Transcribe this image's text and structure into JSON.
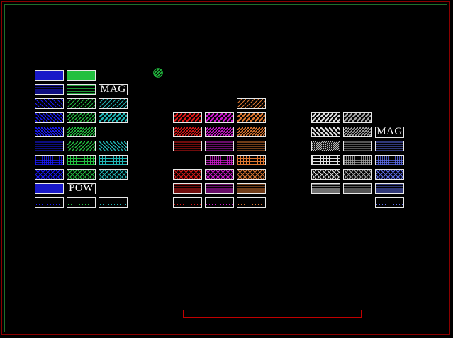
{
  "colors": {
    "background": "#000000",
    "border": "#e8e8e8",
    "blue": "#1a1aff",
    "blue_fill": "#1818c8",
    "green": "#22c040",
    "teal": "#20b8b8",
    "red": "#e01818",
    "magenta": "#d018d0",
    "orange": "#e07830",
    "white": "#e0e0e0",
    "gray": "#a8a8a8",
    "slate": "#6070f0"
  },
  "indicator": {
    "icon": "hatched-circle-icon",
    "color": "#22c040"
  },
  "palette_groups": [
    {
      "name": "group-1",
      "columns": [
        {
          "name": "blue",
          "swatches": [
            "solid",
            "h-dense",
            "d-back-sparse",
            "d-back-med",
            "d-back-dense",
            "h-dense",
            "grid-fine",
            "cross-diag",
            "solid-blue",
            "dots"
          ]
        },
        {
          "name": "green",
          "swatches": [
            "solid",
            "h-stripes",
            "d-fwd-sparse",
            "d-fwd-med",
            "d-fwd-dense",
            "d-fwd-med2",
            "grid-med",
            "cross-diag",
            "label",
            "dots"
          ]
        },
        {
          "name": "teal",
          "swatches": [
            "none",
            "label",
            "d-fwd-sparse",
            "d-fwd-bold",
            "none",
            "d-back-med",
            "grid-med",
            "cross-diag",
            "none",
            "dots"
          ]
        }
      ]
    },
    {
      "name": "group-2",
      "columns": [
        {
          "name": "red",
          "swatches": [
            "none",
            "none",
            "none",
            "d-fwd-bold",
            "d-fwd-dense",
            "h-dense",
            "none",
            "cross-diag",
            "h-dense",
            "dots"
          ]
        },
        {
          "name": "magenta",
          "swatches": [
            "none",
            "none",
            "none",
            "d-fwd-bold",
            "d-fwd-dense",
            "h-dense",
            "grid-fine",
            "cross-diag",
            "h-dense",
            "dots"
          ]
        },
        {
          "name": "orange",
          "swatches": [
            "none",
            "none",
            "d-fwd-sparse",
            "d-fwd-bold",
            "d-fwd-dense",
            "h-dense",
            "grid-med",
            "cross-diag",
            "h-dense",
            "dots"
          ]
        }
      ]
    },
    {
      "name": "group-3",
      "columns": [
        {
          "name": "white",
          "swatches": [
            "none",
            "none",
            "none",
            "d-fwd-bold",
            "d-back-bold",
            "d-fwd-fine",
            "grid-med",
            "cross-diag",
            "h-dense",
            "none"
          ]
        },
        {
          "name": "gray",
          "swatches": [
            "none",
            "none",
            "none",
            "d-fwd-bold",
            "d-fwd-dense",
            "h-dense",
            "grid-fine",
            "cross-diag",
            "h-dense",
            "none"
          ]
        },
        {
          "name": "slate",
          "swatches": [
            "none",
            "none",
            "none",
            "none",
            "label",
            "h-dense",
            "grid-fine",
            "cross-diag",
            "h-dense",
            "dots"
          ]
        }
      ]
    }
  ],
  "labels": {
    "mag_1": "MAG",
    "pow": "POW",
    "mag_2": "MAG"
  }
}
